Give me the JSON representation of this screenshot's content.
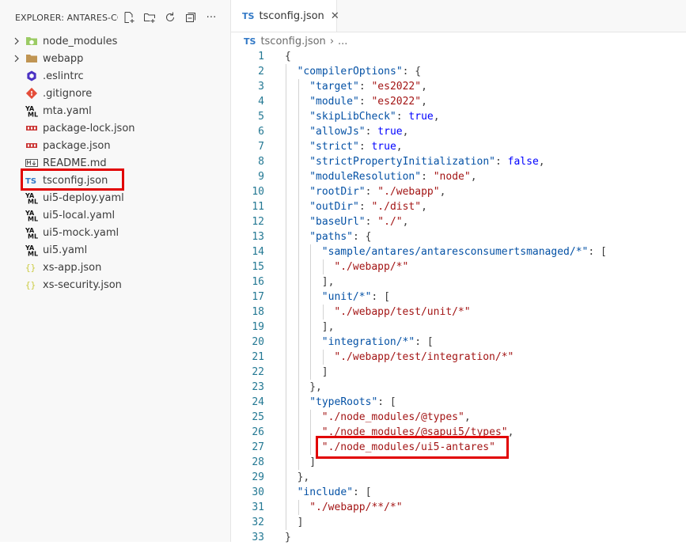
{
  "explorer": {
    "title": "EXPLORER: ANTARES-CO...",
    "actions": [
      "new-file-icon",
      "new-folder-icon",
      "refresh-icon",
      "collapse-all-icon",
      "more-icon"
    ],
    "more_label": "···",
    "items": [
      {
        "label": "node_modules",
        "type": "folder",
        "icon": "node-folder-icon",
        "color": "#8bc34a"
      },
      {
        "label": "webapp",
        "type": "folder",
        "icon": "folder-icon",
        "color": "#c09553"
      },
      {
        "label": ".eslintrc",
        "type": "file",
        "icon": "eslint-icon",
        "color": "#4b32c3"
      },
      {
        "label": ".gitignore",
        "type": "file",
        "icon": "git-icon",
        "color": "#e44d3a"
      },
      {
        "label": "mta.yaml",
        "type": "file",
        "icon": "yaml-icon",
        "color": "#111111"
      },
      {
        "label": "package-lock.json",
        "type": "file",
        "icon": "npm-icon",
        "color": "#cb3837"
      },
      {
        "label": "package.json",
        "type": "file",
        "icon": "npm-icon",
        "color": "#cb3837"
      },
      {
        "label": "README.md",
        "type": "file",
        "icon": "markdown-icon",
        "color": "#555555"
      },
      {
        "label": "tsconfig.json",
        "type": "file",
        "icon": "typescript-icon",
        "color": "#3178c6",
        "highlighted": true
      },
      {
        "label": "ui5-deploy.yaml",
        "type": "file",
        "icon": "yaml-icon",
        "color": "#111111"
      },
      {
        "label": "ui5-local.yaml",
        "type": "file",
        "icon": "yaml-icon",
        "color": "#111111"
      },
      {
        "label": "ui5-mock.yaml",
        "type": "file",
        "icon": "yaml-icon",
        "color": "#111111"
      },
      {
        "label": "ui5.yaml",
        "type": "file",
        "icon": "yaml-icon",
        "color": "#111111"
      },
      {
        "label": "xs-app.json",
        "type": "file",
        "icon": "json-icon",
        "color": "#cbcb41"
      },
      {
        "label": "xs-security.json",
        "type": "file",
        "icon": "json-icon",
        "color": "#cbcb41"
      }
    ]
  },
  "tab": {
    "badge": "TS",
    "label": "tsconfig.json",
    "close": "✕"
  },
  "breadcrumb": {
    "badge": "TS",
    "file": "tsconfig.json",
    "sep": "›",
    "more": "..."
  },
  "code_lines": [
    {
      "n": "1",
      "indent": 0,
      "tokens": [
        [
          "p",
          "{"
        ]
      ]
    },
    {
      "n": "2",
      "indent": 1,
      "tokens": [
        [
          "k",
          "\"compilerOptions\""
        ],
        [
          "p",
          ": {"
        ]
      ]
    },
    {
      "n": "3",
      "indent": 2,
      "tokens": [
        [
          "k",
          "\"target\""
        ],
        [
          "p",
          ": "
        ],
        [
          "s",
          "\"es2022\""
        ],
        [
          "p",
          ","
        ]
      ]
    },
    {
      "n": "4",
      "indent": 2,
      "tokens": [
        [
          "k",
          "\"module\""
        ],
        [
          "p",
          ": "
        ],
        [
          "s",
          "\"es2022\""
        ],
        [
          "p",
          ","
        ]
      ]
    },
    {
      "n": "5",
      "indent": 2,
      "tokens": [
        [
          "k",
          "\"skipLibCheck\""
        ],
        [
          "p",
          ": "
        ],
        [
          "b",
          "true"
        ],
        [
          "p",
          ","
        ]
      ]
    },
    {
      "n": "6",
      "indent": 2,
      "tokens": [
        [
          "k",
          "\"allowJs\""
        ],
        [
          "p",
          ": "
        ],
        [
          "b",
          "true"
        ],
        [
          "p",
          ","
        ]
      ]
    },
    {
      "n": "7",
      "indent": 2,
      "tokens": [
        [
          "k",
          "\"strict\""
        ],
        [
          "p",
          ": "
        ],
        [
          "b",
          "true"
        ],
        [
          "p",
          ","
        ]
      ]
    },
    {
      "n": "8",
      "indent": 2,
      "tokens": [
        [
          "k",
          "\"strictPropertyInitialization\""
        ],
        [
          "p",
          ": "
        ],
        [
          "b",
          "false"
        ],
        [
          "p",
          ","
        ]
      ]
    },
    {
      "n": "9",
      "indent": 2,
      "tokens": [
        [
          "k",
          "\"moduleResolution\""
        ],
        [
          "p",
          ": "
        ],
        [
          "s",
          "\"node\""
        ],
        [
          "p",
          ","
        ]
      ]
    },
    {
      "n": "10",
      "indent": 2,
      "tokens": [
        [
          "k",
          "\"rootDir\""
        ],
        [
          "p",
          ": "
        ],
        [
          "s",
          "\"./webapp\""
        ],
        [
          "p",
          ","
        ]
      ]
    },
    {
      "n": "11",
      "indent": 2,
      "tokens": [
        [
          "k",
          "\"outDir\""
        ],
        [
          "p",
          ": "
        ],
        [
          "s",
          "\"./dist\""
        ],
        [
          "p",
          ","
        ]
      ]
    },
    {
      "n": "12",
      "indent": 2,
      "tokens": [
        [
          "k",
          "\"baseUrl\""
        ],
        [
          "p",
          ": "
        ],
        [
          "s",
          "\"./\""
        ],
        [
          "p",
          ","
        ]
      ]
    },
    {
      "n": "13",
      "indent": 2,
      "tokens": [
        [
          "k",
          "\"paths\""
        ],
        [
          "p",
          ": {"
        ]
      ]
    },
    {
      "n": "14",
      "indent": 3,
      "tokens": [
        [
          "k",
          "\"sample/antares/antaresconsumertsmanaged/*\""
        ],
        [
          "p",
          ": ["
        ]
      ]
    },
    {
      "n": "15",
      "indent": 4,
      "tokens": [
        [
          "s",
          "\"./webapp/*\""
        ]
      ]
    },
    {
      "n": "16",
      "indent": 3,
      "tokens": [
        [
          "p",
          "],"
        ]
      ]
    },
    {
      "n": "17",
      "indent": 3,
      "tokens": [
        [
          "k",
          "\"unit/*\""
        ],
        [
          "p",
          ": ["
        ]
      ]
    },
    {
      "n": "18",
      "indent": 4,
      "tokens": [
        [
          "s",
          "\"./webapp/test/unit/*\""
        ]
      ]
    },
    {
      "n": "19",
      "indent": 3,
      "tokens": [
        [
          "p",
          "],"
        ]
      ]
    },
    {
      "n": "20",
      "indent": 3,
      "tokens": [
        [
          "k",
          "\"integration/*\""
        ],
        [
          "p",
          ": ["
        ]
      ]
    },
    {
      "n": "21",
      "indent": 4,
      "tokens": [
        [
          "s",
          "\"./webapp/test/integration/*\""
        ]
      ]
    },
    {
      "n": "22",
      "indent": 3,
      "tokens": [
        [
          "p",
          "]"
        ]
      ]
    },
    {
      "n": "23",
      "indent": 2,
      "tokens": [
        [
          "p",
          "},"
        ]
      ]
    },
    {
      "n": "24",
      "indent": 2,
      "tokens": [
        [
          "k",
          "\"typeRoots\""
        ],
        [
          "p",
          ": ["
        ]
      ]
    },
    {
      "n": "25",
      "indent": 3,
      "tokens": [
        [
          "s",
          "\"./node_modules/@types\""
        ],
        [
          "p",
          ","
        ]
      ]
    },
    {
      "n": "26",
      "indent": 3,
      "tokens": [
        [
          "s",
          "\"./node_modules/@sapui5/types\""
        ],
        [
          "p",
          ","
        ]
      ]
    },
    {
      "n": "27",
      "indent": 3,
      "tokens": [
        [
          "s",
          "\"./node_modules/ui5-antares\""
        ]
      ],
      "highlighted": true
    },
    {
      "n": "28",
      "indent": 2,
      "tokens": [
        [
          "p",
          "]"
        ]
      ]
    },
    {
      "n": "29",
      "indent": 1,
      "tokens": [
        [
          "p",
          "},"
        ]
      ]
    },
    {
      "n": "30",
      "indent": 1,
      "tokens": [
        [
          "k",
          "\"include\""
        ],
        [
          "p",
          ": ["
        ]
      ]
    },
    {
      "n": "31",
      "indent": 2,
      "tokens": [
        [
          "s",
          "\"./webapp/**/*\""
        ]
      ]
    },
    {
      "n": "32",
      "indent": 1,
      "tokens": [
        [
          "p",
          "]"
        ]
      ]
    },
    {
      "n": "33",
      "indent": 0,
      "tokens": [
        [
          "p",
          "}"
        ]
      ]
    }
  ],
  "colors": {
    "highlight_box": "#e10000",
    "keyword": "#0451a5",
    "string": "#a31515",
    "boolean": "#0000ff",
    "line_number": "#237893"
  }
}
